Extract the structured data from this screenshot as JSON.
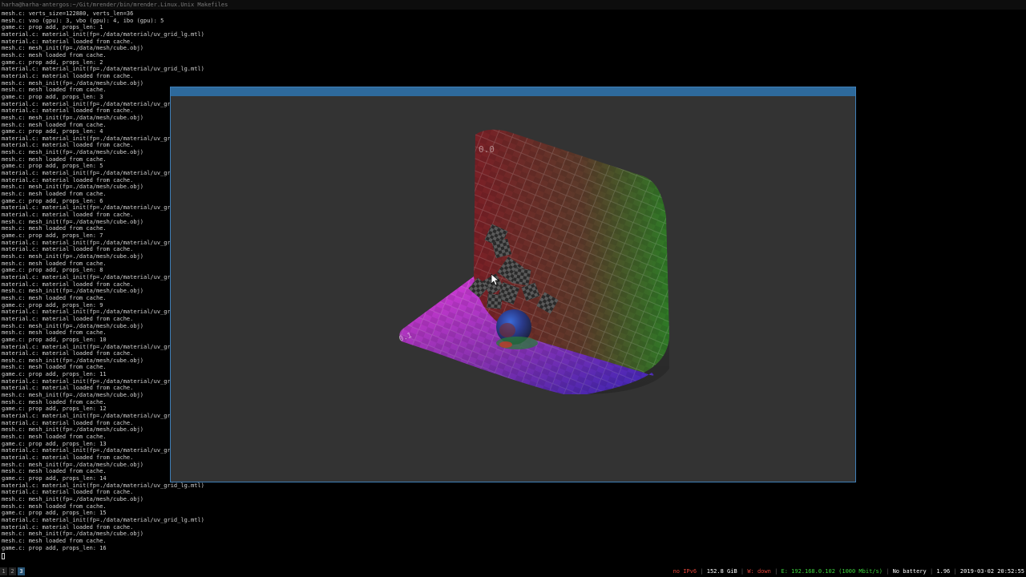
{
  "terminal": {
    "title": "harha@harha-antergos:~/Git/mrender/bin/mrender.Linux.Unix Makefiles",
    "lines": [
      "mesh.c: verts_size=122880, verts_len=36",
      "mesh.c: vao (gpu): 3, vbo (gpu): 4, ibo (gpu): 5",
      "game.c: prop add, props_len: 1",
      "material.c: material_init(fp=./data/material/uv_grid_lg.mtl)",
      "material.c: material loaded from cache.",
      "mesh.c: mesh_init(fp=./data/mesh/cube.obj)",
      "mesh.c: mesh loaded from cache.",
      "game.c: prop add, props_len: 2",
      "material.c: material_init(fp=./data/material/uv_grid_lg.mtl)",
      "material.c: material loaded from cache.",
      "mesh.c: mesh_init(fp=./data/mesh/cube.obj)",
      "mesh.c: mesh loaded from cache.",
      "game.c: prop add, props_len: 3",
      "material.c: material_init(fp=./data/material/uv_grid",
      "material.c: material loaded from cache.",
      "mesh.c: mesh_init(fp=./data/mesh/cube.obj)",
      "mesh.c: mesh loaded from cache.",
      "game.c: prop add, props_len: 4",
      "material.c: material_init(fp=./data/material/uv_grid",
      "material.c: material loaded from cache.",
      "mesh.c: mesh_init(fp=./data/mesh/cube.obj)",
      "mesh.c: mesh loaded from cache.",
      "game.c: prop add, props_len: 5",
      "material.c: material_init(fp=./data/material/uv_grid",
      "material.c: material loaded from cache.",
      "mesh.c: mesh_init(fp=./data/mesh/cube.obj)",
      "mesh.c: mesh loaded from cache.",
      "game.c: prop add, props_len: 6",
      "material.c: material_init(fp=./data/material/uv_grid",
      "material.c: material loaded from cache.",
      "mesh.c: mesh_init(fp=./data/mesh/cube.obj)",
      "mesh.c: mesh loaded from cache.",
      "game.c: prop add, props_len: 7",
      "material.c: material_init(fp=./data/material/uv_grid",
      "material.c: material loaded from cache.",
      "mesh.c: mesh_init(fp=./data/mesh/cube.obj)",
      "mesh.c: mesh loaded from cache.",
      "game.c: prop add, props_len: 8",
      "material.c: material_init(fp=./data/material/uv_grid",
      "material.c: material loaded from cache.",
      "mesh.c: mesh_init(fp=./data/mesh/cube.obj)",
      "mesh.c: mesh loaded from cache.",
      "game.c: prop add, props_len: 9",
      "material.c: material_init(fp=./data/material/uv_grid",
      "material.c: material loaded from cache.",
      "mesh.c: mesh_init(fp=./data/mesh/cube.obj)",
      "mesh.c: mesh loaded from cache.",
      "game.c: prop add, props_len: 10",
      "material.c: material_init(fp=./data/material/uv_grid",
      "material.c: material loaded from cache.",
      "mesh.c: mesh_init(fp=./data/mesh/cube.obj)",
      "mesh.c: mesh loaded from cache.",
      "game.c: prop add, props_len: 11",
      "material.c: material_init(fp=./data/material/uv_grid",
      "material.c: material loaded from cache.",
      "mesh.c: mesh_init(fp=./data/mesh/cube.obj)",
      "mesh.c: mesh loaded from cache.",
      "game.c: prop add, props_len: 12",
      "material.c: material_init(fp=./data/material/uv_grid",
      "material.c: material loaded from cache.",
      "mesh.c: mesh_init(fp=./data/mesh/cube.obj)",
      "mesh.c: mesh loaded from cache.",
      "game.c: prop add, props_len: 13",
      "material.c: material_init(fp=./data/material/uv_grid",
      "material.c: material loaded from cache.",
      "mesh.c: mesh_init(fp=./data/mesh/cube.obj)",
      "mesh.c: mesh loaded from cache.",
      "game.c: prop add, props_len: 14",
      "material.c: material_init(fp=./data/material/uv_grid_lg.mtl)",
      "material.c: material loaded from cache.",
      "mesh.c: mesh_init(fp=./data/mesh/cube.obj)",
      "mesh.c: mesh loaded from cache.",
      "game.c: prop add, props_len: 15",
      "material.c: material_init(fp=./data/material/uv_grid_lg.mtl)",
      "material.c: material loaded from cache.",
      "mesh.c: mesh_init(fp=./data/mesh/cube.obj)",
      "mesh.c: mesh loaded from cache.",
      "game.c: prop add, props_len: 16"
    ]
  },
  "render_window": {
    "grid_labels": {
      "back": "0.0",
      "front": "0.1"
    }
  },
  "status_bar": {
    "workspaces": [
      "1",
      "2",
      "3"
    ],
    "active_workspace": "3",
    "ipv6": "no IPv6",
    "disk": "152.8 GiB",
    "wireless": "W: down",
    "ethernet": "E: 192.168.0.102 (1000 Mbit/s)",
    "battery": "No battery",
    "load": "1.96",
    "datetime": "2019-03-02 20:52:55"
  },
  "colors": {
    "ipv6": "#e0443a",
    "wireless": "#e0443a",
    "ethernet": "#3cd23c",
    "window_border": "#3f7fb8",
    "window_title": "#2e6a9c",
    "viewport_bg": "#333333"
  }
}
